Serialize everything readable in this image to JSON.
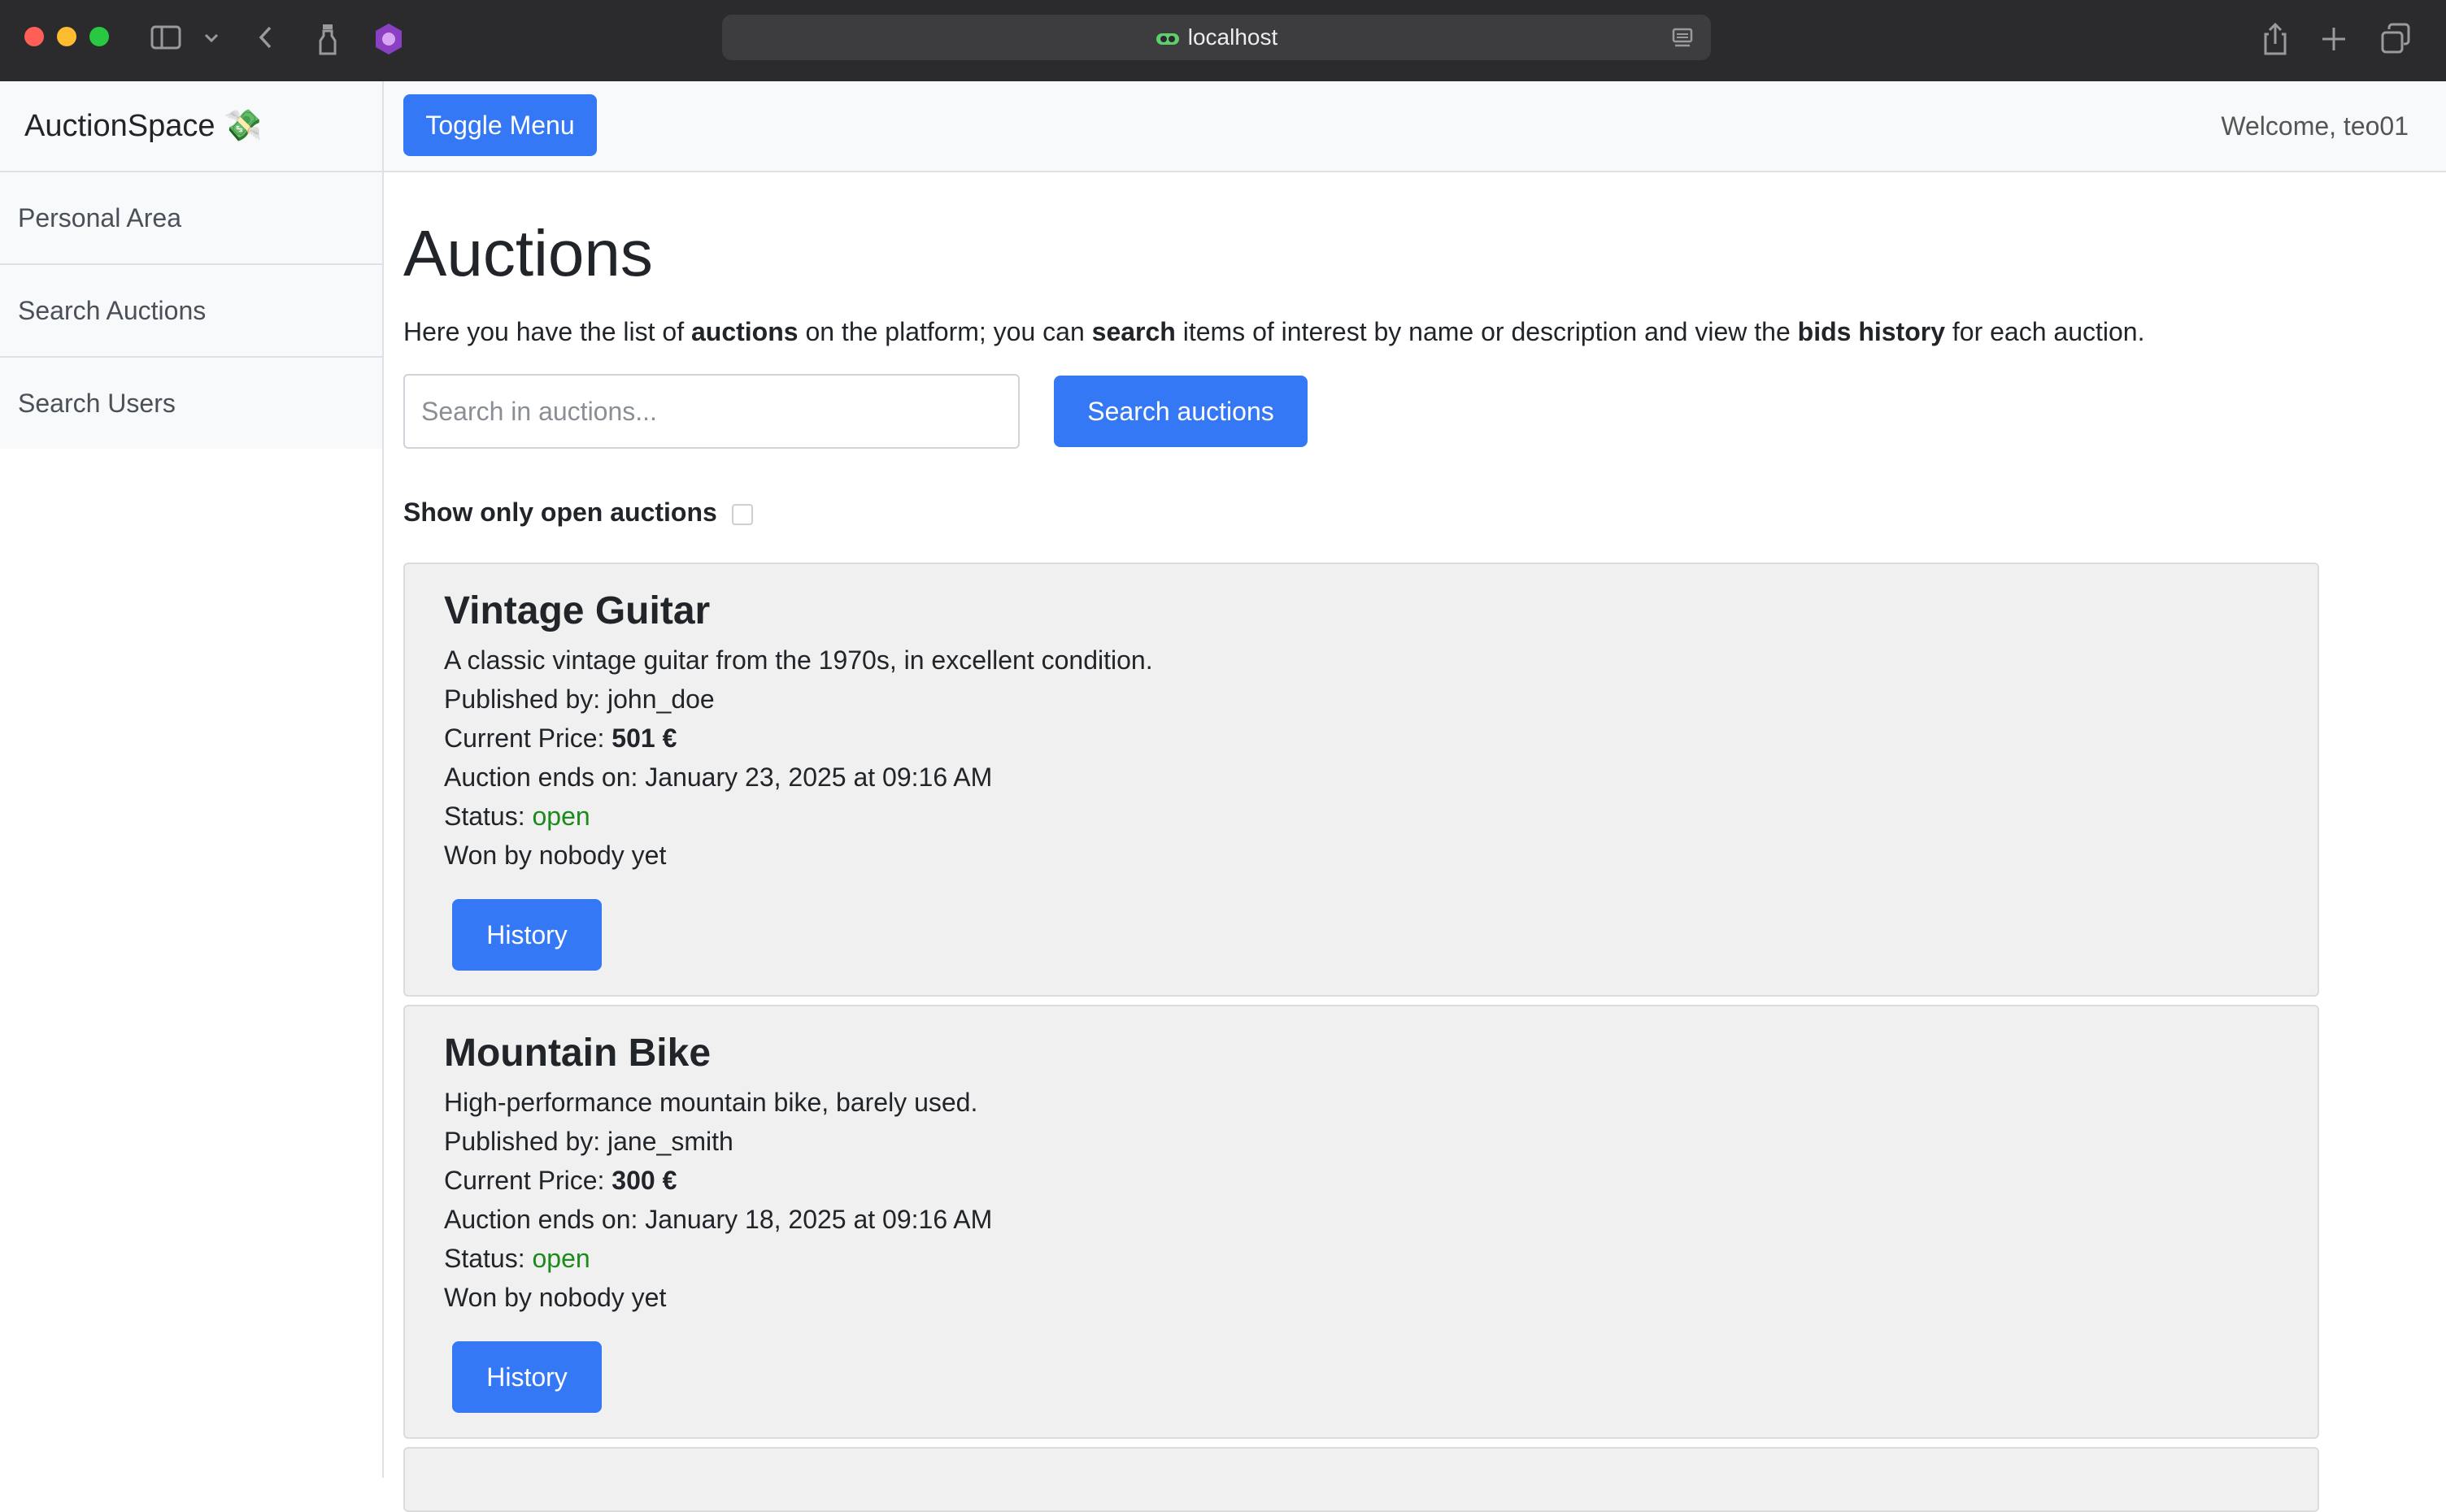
{
  "browser": {
    "url": "localhost"
  },
  "app": {
    "brand": "AuctionSpace",
    "brand_emoji": "💸",
    "toggle_menu_label": "Toggle Menu",
    "welcome_text": "Welcome, teo01"
  },
  "sidebar": {
    "items": [
      {
        "label": "Personal Area"
      },
      {
        "label": "Search Auctions"
      },
      {
        "label": "Search Users"
      }
    ]
  },
  "main": {
    "title": "Auctions",
    "intro": {
      "p1": "Here you have the list of ",
      "b1": "auctions",
      "p2": " on the platform; you can ",
      "b2": "search",
      "p3": " items of interest by name or description and view the ",
      "b3": "bids history",
      "p4": " for each auction."
    },
    "search": {
      "placeholder": "Search in auctions...",
      "value": "",
      "button_label": "Search auctions"
    },
    "filter": {
      "label": "Show only open auctions",
      "checked": false
    },
    "auctions": [
      {
        "title": "Vintage Guitar",
        "description": "A classic vintage guitar from the 1970s, in excellent condition.",
        "published_label": "Published by: ",
        "published_by": "john_doe",
        "price_label": "Current Price: ",
        "price": "501 €",
        "ends_label": "Auction ends on: ",
        "ends_on": "January 23, 2025 at 09:16 AM",
        "status_label": "Status: ",
        "status": "open",
        "winner": "Won by nobody yet",
        "history_label": "History"
      },
      {
        "title": "Mountain Bike",
        "description": "High-performance mountain bike, barely used.",
        "published_label": "Published by: ",
        "published_by": "jane_smith",
        "price_label": "Current Price: ",
        "price": "300 €",
        "ends_label": "Auction ends on: ",
        "ends_on": "January 18, 2025 at 09:16 AM",
        "status_label": "Status: ",
        "status": "open",
        "winner": "Won by nobody yet",
        "history_label": "History"
      }
    ]
  },
  "colors": {
    "primary": "#3478f6",
    "status_open": "#1a8a1a",
    "card_bg": "#f0f0f0"
  },
  "icons": [
    "sidebar-icon",
    "chevron-down-icon",
    "back-icon",
    "extension-icon",
    "privacy-icon",
    "lock-icon",
    "reader-icon",
    "share-icon",
    "new-tab-icon",
    "tabs-overview-icon"
  ]
}
